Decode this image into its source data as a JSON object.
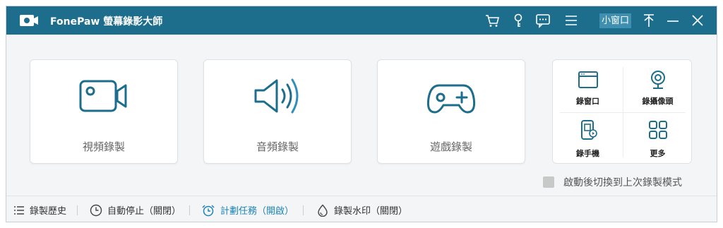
{
  "app": {
    "title": "FonePaw 螢幕錄影大師",
    "mini_window_label": "小窗口",
    "logo_icon": "camera-logo-icon",
    "brand_color": "#1d6d8c"
  },
  "titlebar_icons": [
    "cart-icon",
    "key-icon",
    "chat-icon",
    "menu-icon",
    "pin-icon",
    "minimize-icon",
    "close-icon"
  ],
  "cards": {
    "video": {
      "label": "視頻錄製",
      "icon": "video-camera-icon"
    },
    "audio": {
      "label": "音頻錄製",
      "icon": "speaker-icon"
    },
    "game": {
      "label": "遊戲錄製",
      "icon": "gamepad-icon"
    }
  },
  "grid": {
    "window_record": {
      "label": "錄窗口",
      "icon": "window-icon"
    },
    "webcam": {
      "label": "錄攝像頭",
      "icon": "webcam-icon"
    },
    "phone": {
      "label": "錄手機",
      "icon": "phone-icon"
    },
    "more": {
      "label": "更多",
      "icon": "grid-icon"
    }
  },
  "checkbox": {
    "label": "啟動後切換到上次錄製模式",
    "checked": false
  },
  "bottom": {
    "history": "錄製歷史",
    "auto_stop": "自動停止（關閉）",
    "schedule": "計劃任務（開啟）",
    "watermark": "錄製水印（關閉）"
  },
  "accent_color": "#1d84b5"
}
